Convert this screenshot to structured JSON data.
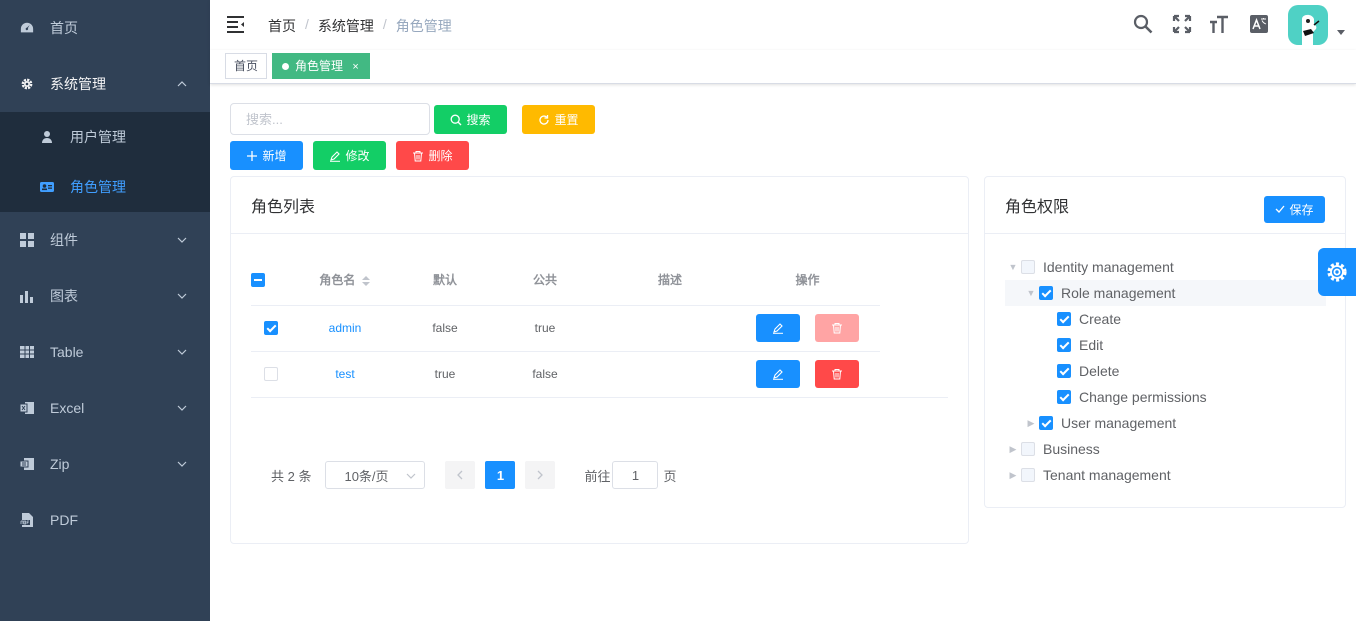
{
  "sidebar": {
    "items": [
      {
        "label": "首页",
        "icon": "dashboard-icon"
      },
      {
        "label": "系统管理",
        "icon": "gear-icon",
        "expanded": true,
        "children": [
          {
            "label": "用户管理",
            "icon": "user-icon"
          },
          {
            "label": "角色管理",
            "icon": "id-card-icon",
            "active": true
          }
        ]
      },
      {
        "label": "组件",
        "icon": "components-icon"
      },
      {
        "label": "图表",
        "icon": "chart-icon"
      },
      {
        "label": "Table",
        "icon": "table-icon"
      },
      {
        "label": "Excel",
        "icon": "excel-icon"
      },
      {
        "label": "Zip",
        "icon": "zip-icon"
      },
      {
        "label": "PDF",
        "icon": "pdf-icon"
      }
    ],
    "colors": {
      "bg": "#304156",
      "submenu_bg": "#1f2d3d",
      "text": "#bfcbd9",
      "active": "#409eff"
    }
  },
  "navbar": {
    "breadcrumb": [
      "首页",
      "系统管理",
      "角色管理"
    ],
    "icons": [
      "search-icon",
      "fullscreen-icon",
      "font-size-icon",
      "translate-icon"
    ]
  },
  "tags": [
    {
      "label": "首页"
    },
    {
      "label": "角色管理",
      "close": "×",
      "active": true
    }
  ],
  "toolbar": {
    "search_placeholder": "搜索...",
    "search_label": "搜索",
    "reset_label": "重置",
    "add_label": "新增",
    "edit_label": "修改",
    "delete_label": "删除"
  },
  "roles_card": {
    "title": "角色列表",
    "columns": [
      "角色名",
      "默认",
      "公共",
      "描述",
      "操作"
    ],
    "rows": [
      {
        "name": "admin",
        "default": "false",
        "public": "true",
        "desc": "",
        "checked": true
      },
      {
        "name": "test",
        "default": "true",
        "public": "false",
        "desc": "",
        "checked": false
      }
    ],
    "pagination": {
      "total": "共 2 条",
      "page_size": "10条/页",
      "current": "1",
      "goto_prefix": "前往",
      "goto_value": "1",
      "goto_suffix": "页"
    }
  },
  "perm_card": {
    "title": "角色权限",
    "save_label": "保存",
    "tree": [
      {
        "label": "Identity management",
        "state": "off",
        "caret": "down"
      },
      {
        "label": "Role management",
        "state": "on",
        "caret": "down"
      },
      {
        "label": "Create",
        "state": "on",
        "caret": ""
      },
      {
        "label": "Edit",
        "state": "on",
        "caret": ""
      },
      {
        "label": "Delete",
        "state": "on",
        "caret": ""
      },
      {
        "label": "Change permissions",
        "state": "on",
        "caret": ""
      },
      {
        "label": "User management",
        "state": "on",
        "caret": "right"
      },
      {
        "label": "Business",
        "state": "off",
        "caret": "right"
      },
      {
        "label": "Tenant management",
        "state": "off",
        "caret": "right"
      }
    ]
  },
  "colors": {
    "primary": "#1890ff",
    "success": "#13ce66",
    "warning": "#ffba00",
    "danger": "#ff4949",
    "danger_disabled": "#ffa4a4",
    "tag_active": "#42b983"
  }
}
